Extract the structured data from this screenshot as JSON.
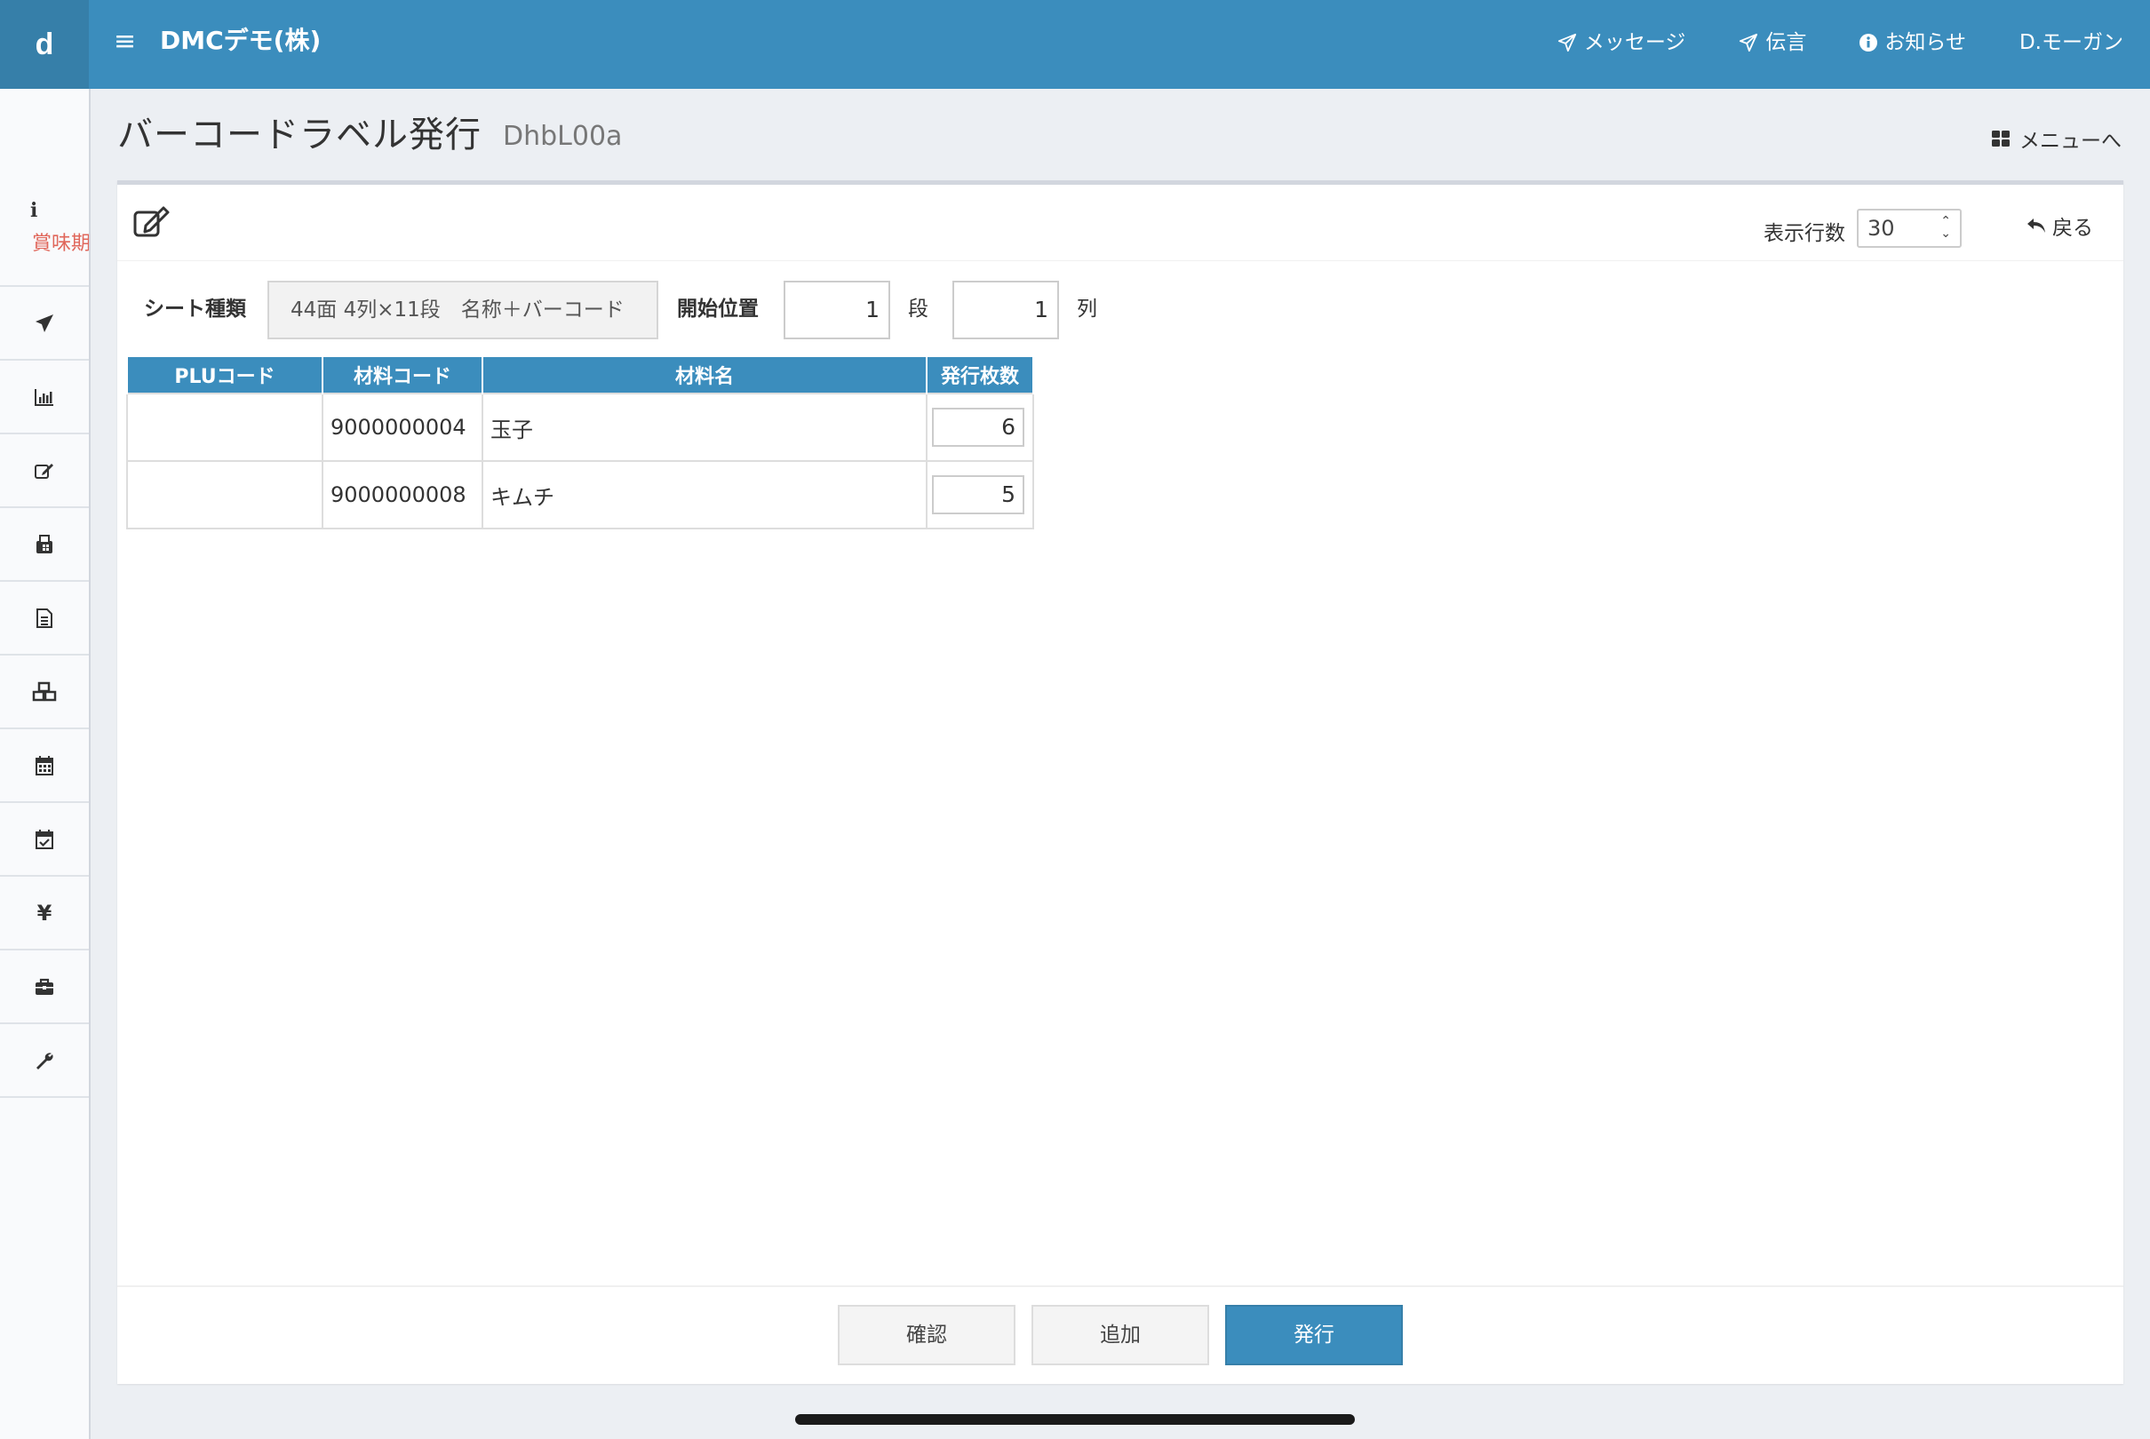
{
  "app": {
    "logo": "d",
    "company": "DMCデモ(株)"
  },
  "topnav": {
    "messages": "メッセージ",
    "memo": "伝言",
    "notices": "お知らせ",
    "user": "D.モーガン"
  },
  "sidebar": {
    "notice_text": "賞味期",
    "items": [
      "send-icon",
      "bar-chart-icon",
      "edit-icon",
      "fax-icon",
      "file-text-icon",
      "cubes-icon",
      "calendar-icon",
      "calendar-check-icon",
      "yen-icon",
      "briefcase-icon",
      "wrench-icon"
    ],
    "yen_symbol": "¥"
  },
  "page": {
    "title": "バーコードラベル発行",
    "code": "DhbL00a",
    "menu_link": "メニューへ"
  },
  "card": {
    "rows_label": "表示行数",
    "rows_value": "30",
    "back_label": "戻る"
  },
  "form": {
    "sheet_label": "シート種類",
    "sheet_value": "44面 4列×11段　名称＋バーコード",
    "start_label": "開始位置",
    "row_value": "1",
    "row_unit": "段",
    "col_value": "1",
    "col_unit": "列"
  },
  "table": {
    "headers": [
      "PLUコード",
      "材料コード",
      "材料名",
      "発行枚数"
    ],
    "rows": [
      {
        "plu": "",
        "code": "9000000004",
        "name": "玉子",
        "qty": "6"
      },
      {
        "plu": "",
        "code": "9000000008",
        "name": "キムチ",
        "qty": "5"
      }
    ]
  },
  "footer": {
    "confirm": "確認",
    "add": "追加",
    "issue": "発行"
  },
  "colors": {
    "header_blue": "#3b8dbd",
    "notice_red": "#e0675b"
  }
}
